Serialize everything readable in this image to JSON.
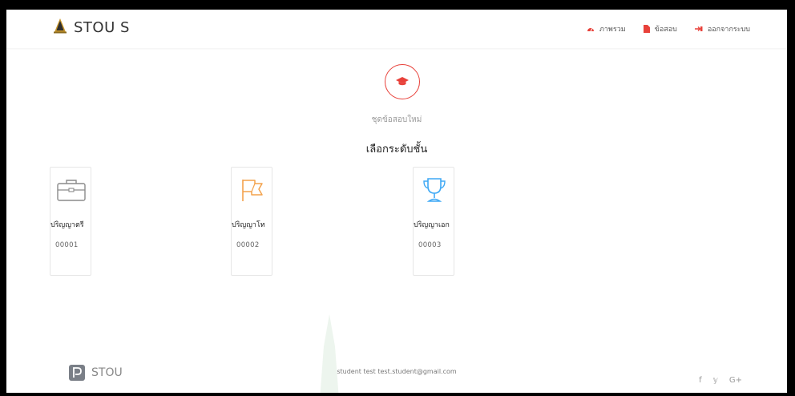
{
  "colors": {
    "accent": "#e8413a",
    "orange": "#f3a24c",
    "blue": "#3fa9f5",
    "gray": "#8a8a8a"
  },
  "header": {
    "brand": "STOU S",
    "nav": [
      {
        "label": "ภาพรวม",
        "icon": "dashboard-icon"
      },
      {
        "label": "ข้อสอบ",
        "icon": "file-icon"
      },
      {
        "label": "ออกจากระบบ",
        "icon": "sign-out-icon"
      }
    ]
  },
  "main": {
    "hero_icon": "graduation-cap-icon",
    "subtitle": "ชุดข้อสอบใหม่",
    "heading": "เลือกระดับชั้น",
    "levels": [
      {
        "title": "ปริญญาตรี",
        "code": "00001",
        "icon": "briefcase-icon"
      },
      {
        "title": "ปริญญาโท",
        "code": "00002",
        "icon": "flag-icon"
      },
      {
        "title": "ปริญญาเอก",
        "code": "00003",
        "icon": "trophy-icon"
      }
    ]
  },
  "footer": {
    "brand": "STOU",
    "user_info": "student test test.student@gmail.com",
    "social": [
      "f",
      "𝕪",
      "G+"
    ]
  }
}
